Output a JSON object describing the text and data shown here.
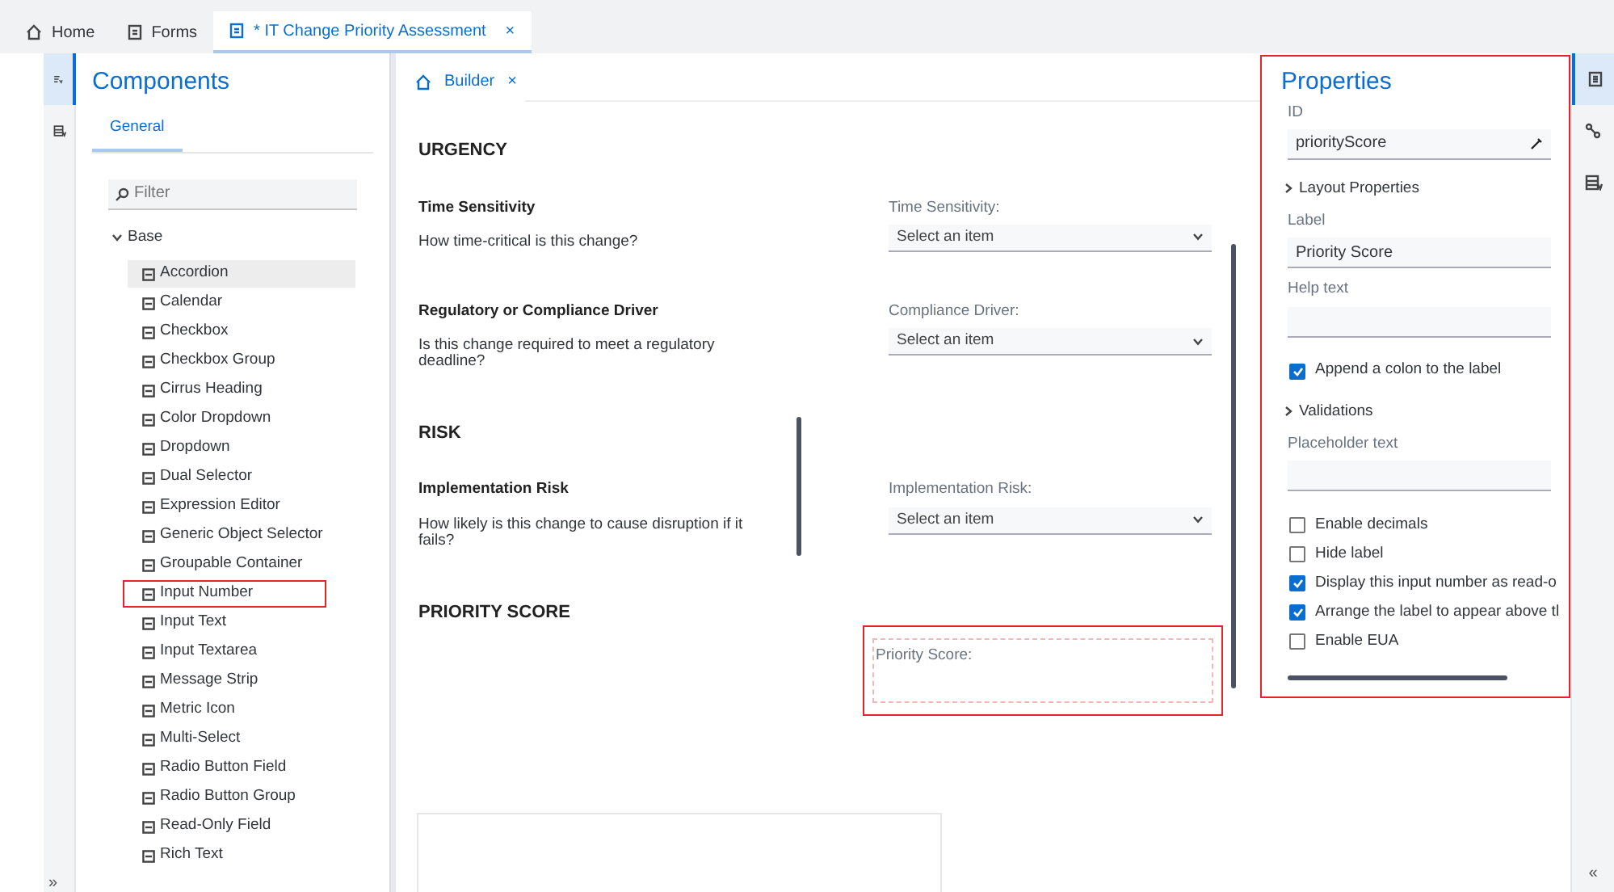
{
  "tabs": [
    {
      "kind": "home",
      "label": "Home",
      "selected": false
    },
    {
      "kind": "forms",
      "label": "Forms",
      "selected": false
    },
    {
      "kind": "document",
      "label": "* IT Change Priority Assessment",
      "selected": true,
      "close": "×"
    }
  ],
  "left_rail": [
    {
      "kind": "components",
      "selected": true
    },
    {
      "kind": "list",
      "selected": false
    }
  ],
  "components": {
    "title": "Components",
    "subtabs": [
      {
        "label": "General",
        "selected": true
      }
    ],
    "filter_placeholder": "Filter",
    "group": {
      "label": "Base",
      "expanded": true,
      "items": [
        {
          "label": "Accordion",
          "selected": true,
          "highlighted": false
        },
        {
          "label": "Calendar",
          "selected": false,
          "highlighted": false
        },
        {
          "label": "Checkbox",
          "selected": false,
          "highlighted": false
        },
        {
          "label": "Checkbox Group",
          "selected": false,
          "highlighted": false
        },
        {
          "label": "Cirrus Heading",
          "selected": false,
          "highlighted": false
        },
        {
          "label": "Color Dropdown",
          "selected": false,
          "highlighted": false
        },
        {
          "label": "Dropdown",
          "selected": false,
          "highlighted": false
        },
        {
          "label": "Dual Selector",
          "selected": false,
          "highlighted": false
        },
        {
          "label": "Expression Editor",
          "selected": false,
          "highlighted": false
        },
        {
          "label": "Generic Object Selector",
          "selected": false,
          "highlighted": false
        },
        {
          "label": "Groupable Container",
          "selected": false,
          "highlighted": false
        },
        {
          "label": "Input Number",
          "selected": false,
          "highlighted": true
        },
        {
          "label": "Input Text",
          "selected": false,
          "highlighted": false
        },
        {
          "label": "Input Textarea",
          "selected": false,
          "highlighted": false
        },
        {
          "label": "Message Strip",
          "selected": false,
          "highlighted": false
        },
        {
          "label": "Metric Icon",
          "selected": false,
          "highlighted": false
        },
        {
          "label": "Multi-Select",
          "selected": false,
          "highlighted": false
        },
        {
          "label": "Radio Button Field",
          "selected": false,
          "highlighted": false
        },
        {
          "label": "Radio Button Group",
          "selected": false,
          "highlighted": false
        },
        {
          "label": "Read-Only Field",
          "selected": false,
          "highlighted": false
        },
        {
          "label": "Rich Text",
          "selected": false,
          "highlighted": false
        }
      ]
    },
    "collapse": "»"
  },
  "builder": {
    "tab": {
      "label": "Builder",
      "close": "×"
    },
    "sections": [
      {
        "heading": "URGENCY",
        "questions": [
          {
            "title": "Time Sensitivity",
            "description": "How time-critical is this change?",
            "field_label": "Time Sensitivity:",
            "placeholder": "Select an item"
          },
          {
            "title": "Regulatory or Compliance Driver",
            "description": "Is this change required to meet a regulatory deadline?",
            "field_label": "Compliance Driver:",
            "placeholder": "Select an item"
          }
        ]
      },
      {
        "heading": "RISK",
        "questions": [
          {
            "title": "Implementation Risk",
            "description": "How likely is this change to cause disruption if it fails?",
            "field_label": "Implementation Risk:",
            "placeholder": "Select an item"
          }
        ]
      },
      {
        "heading": "PRIORITY SCORE",
        "score_field": {
          "label": "Priority Score:",
          "highlighted": true
        }
      }
    ]
  },
  "properties": {
    "title": "Properties",
    "highlighted": true,
    "items": [
      {
        "kind": "field",
        "label": "ID",
        "value": "priorityScore",
        "editable": true
      },
      {
        "kind": "expander",
        "label": "Layout Properties",
        "expanded": false
      },
      {
        "kind": "field",
        "label": "Label",
        "value": "Priority Score"
      },
      {
        "kind": "field",
        "label": "Help text"
      },
      {
        "kind": "checkbox",
        "label": "Append a colon to the label",
        "checked": true
      },
      {
        "kind": "expander",
        "label": "Validations",
        "expanded": false
      },
      {
        "kind": "field",
        "label": "Placeholder text"
      },
      {
        "kind": "checkbox",
        "label": "Enable decimals",
        "checked": false
      },
      {
        "kind": "checkbox",
        "label": "Hide label",
        "checked": false
      },
      {
        "kind": "checkbox",
        "label": "Display this input number as read-o",
        "checked": true
      },
      {
        "kind": "checkbox",
        "label": "Arrange the label to appear above tl",
        "checked": true
      },
      {
        "kind": "checkbox",
        "label": "Enable EUA",
        "checked": false
      }
    ]
  },
  "right_rail": {
    "items": [
      {
        "kind": "properties",
        "selected": true
      },
      {
        "kind": "links",
        "selected": false
      },
      {
        "kind": "list",
        "selected": false
      }
    ],
    "collapse": "«"
  }
}
